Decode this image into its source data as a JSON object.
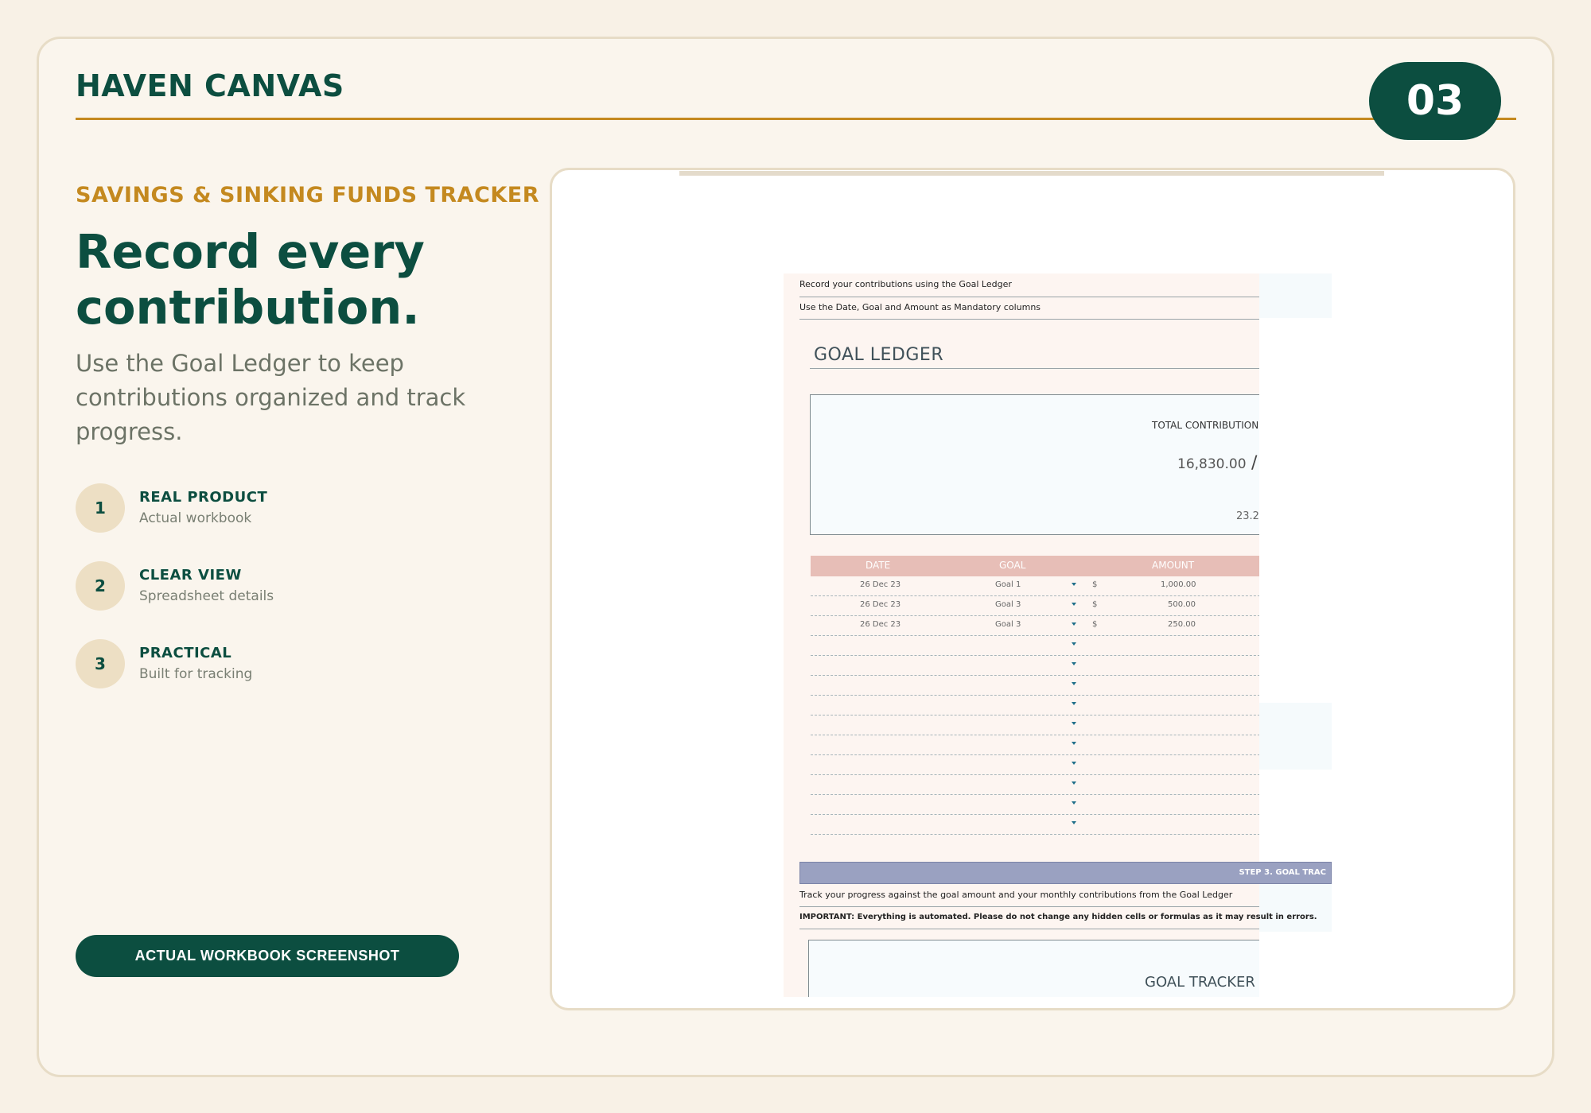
{
  "header": {
    "brand": "HAVEN CANVAS",
    "page_number": "03"
  },
  "intro": {
    "eyebrow": "SAVINGS & SINKING FUNDS TRACKER",
    "headline": "Record every contribution.",
    "description": "Use the Goal Ledger to keep contributions organized and track progress."
  },
  "features": [
    {
      "num": "1",
      "title": "REAL PRODUCT",
      "subtitle": "Actual workbook"
    },
    {
      "num": "2",
      "title": "CLEAR VIEW",
      "subtitle": "Spreadsheet details"
    },
    {
      "num": "3",
      "title": "PRACTICAL",
      "subtitle": "Built for tracking"
    }
  ],
  "cta_label": "ACTUAL WORKBOOK SCREENSHOT",
  "workbook": {
    "note1": "Record your contributions using the Goal Ledger",
    "note2": "Use the Date, Goal and Amount as Mandatory columns",
    "ledger_title": "GOAL LEDGER",
    "total_label": "TOTAL CONTRIBUTION",
    "total_value": "16,830.00",
    "slash": "/",
    "percent_partial": "23.2",
    "columns": [
      "DATE",
      "GOAL",
      "AMOUNT"
    ],
    "rows": [
      {
        "date": "26 Dec 23",
        "goal": "Goal 1",
        "currency": "$",
        "amount": "1,000.00"
      },
      {
        "date": "26 Dec 23",
        "goal": "Goal 3",
        "currency": "$",
        "amount": "500.00"
      },
      {
        "date": "26 Dec 23",
        "goal": "Goal 3",
        "currency": "$",
        "amount": "250.00"
      }
    ],
    "step_label": "STEP 3. GOAL TRAC",
    "note3": "Track your progress against the goal amount and your monthly contributions from the Goal Ledger",
    "note4": "IMPORTANT: Everything is automated. Please do not change any hidden cells or formulas as it may result in errors.",
    "tracker_title": "GOAL TRACKER"
  },
  "colors": {
    "primary": "#0c4e40",
    "accent": "#c4891f",
    "background": "#f8f1e6"
  }
}
